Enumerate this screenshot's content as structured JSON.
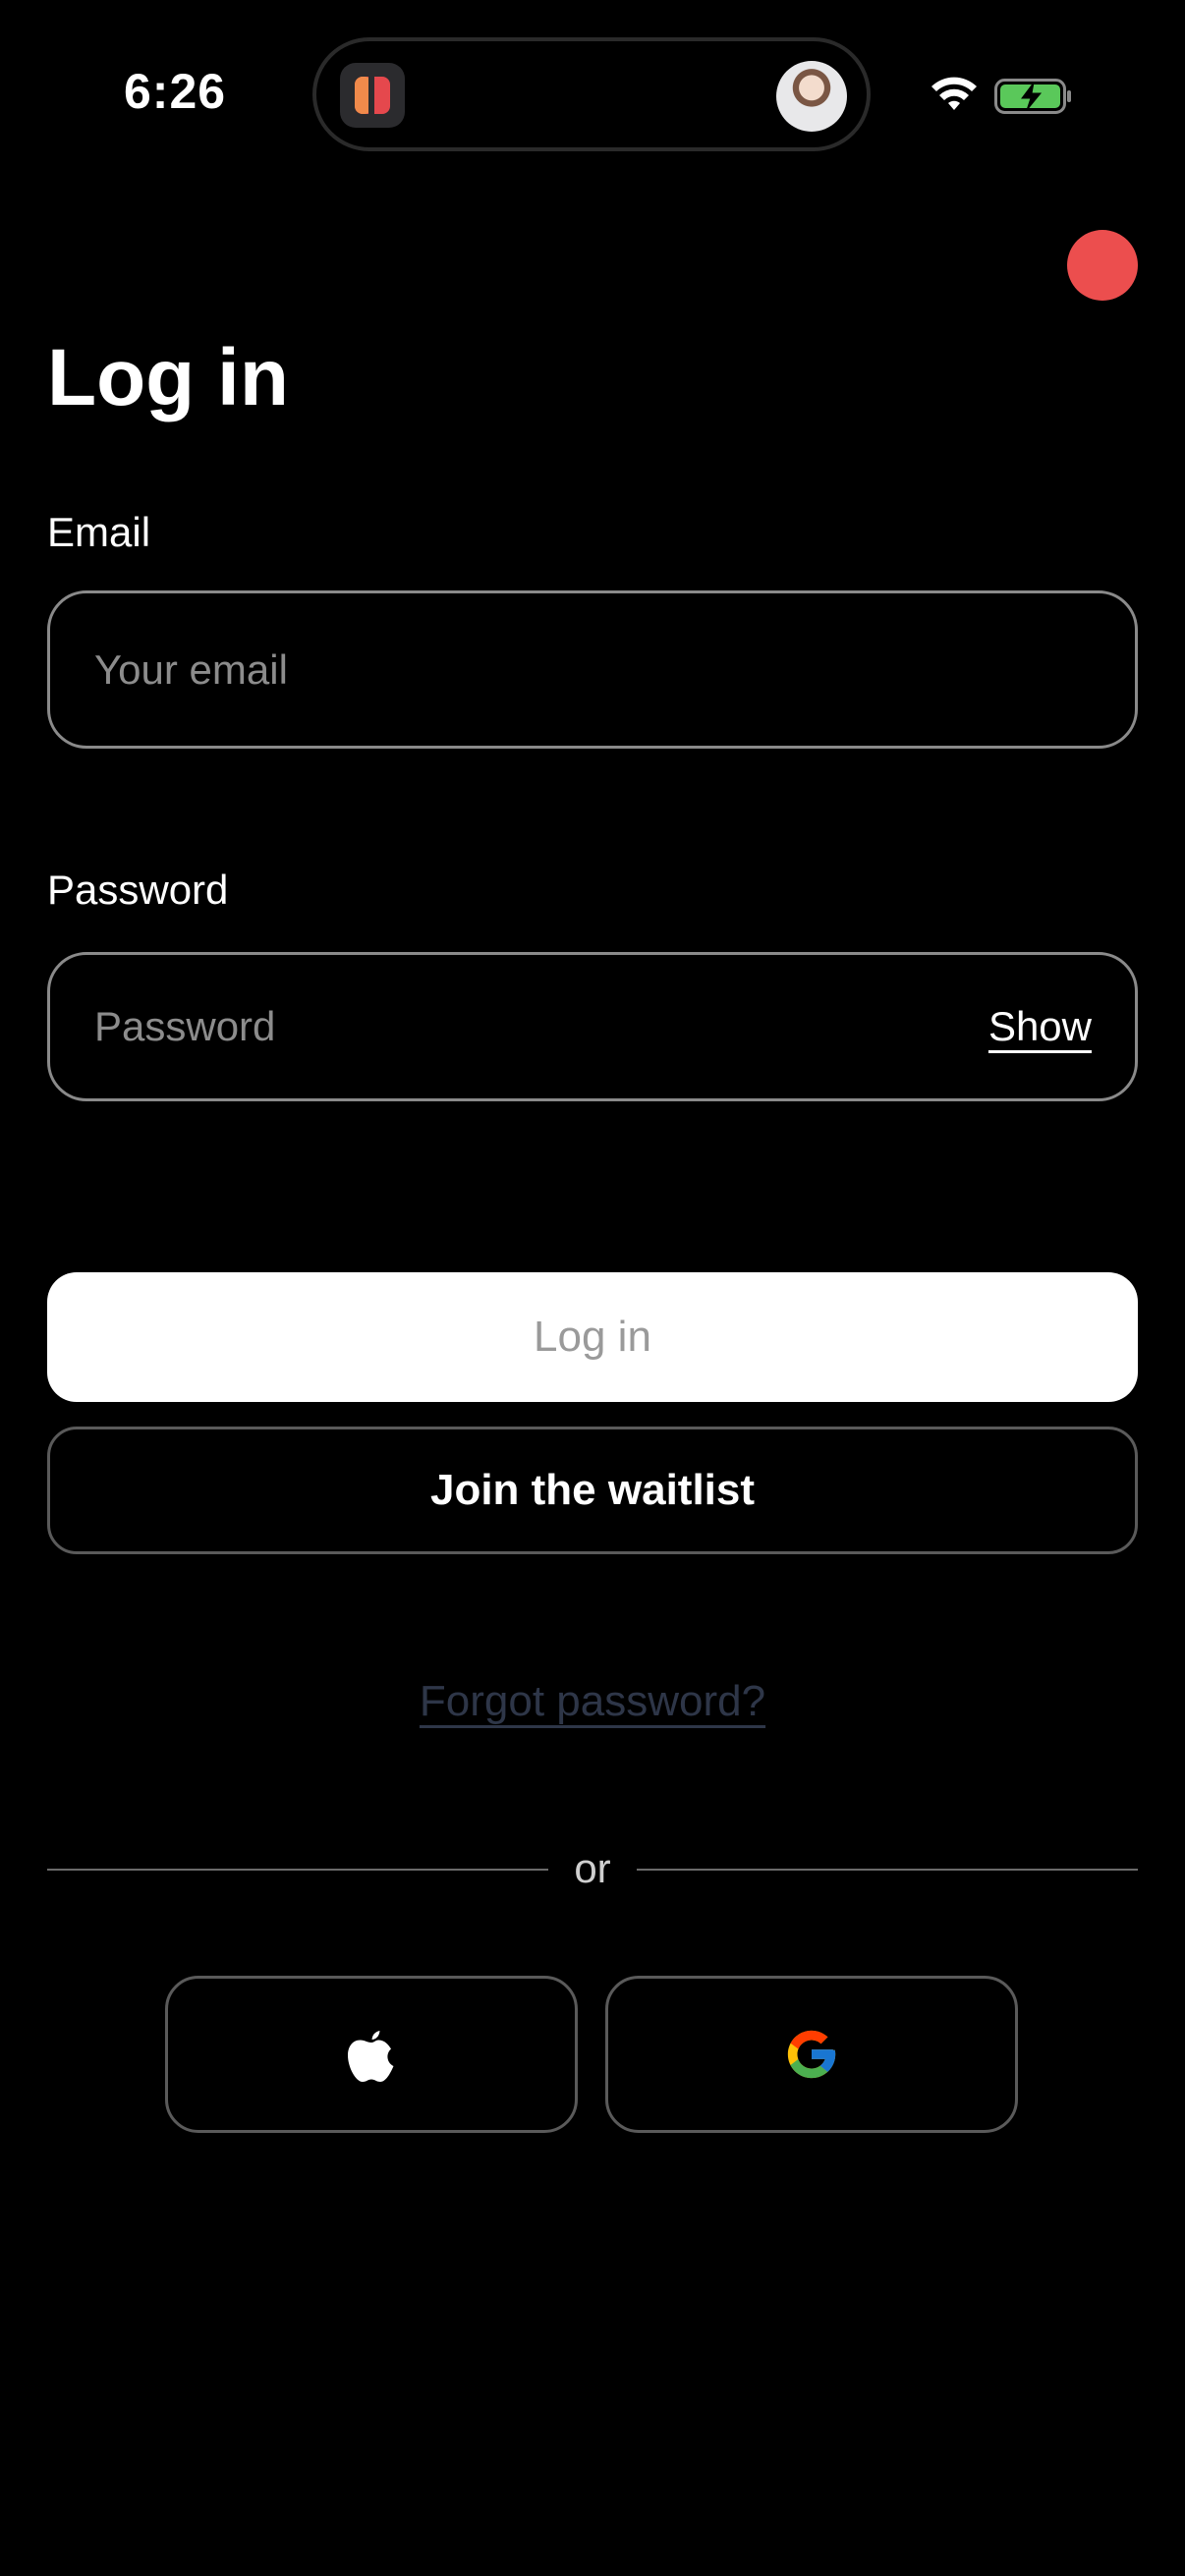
{
  "status_bar": {
    "time": "6:26",
    "icons": [
      "app-icon",
      "avatar",
      "wifi-icon",
      "battery-charging-icon"
    ]
  },
  "page": {
    "title": "Log in"
  },
  "email": {
    "label": "Email",
    "placeholder": "Your email",
    "value": ""
  },
  "password": {
    "label": "Password",
    "placeholder": "Password",
    "value": "",
    "toggle_label": "Show"
  },
  "actions": {
    "login_label": "Log in",
    "waitlist_label": "Join the waitlist",
    "forgot_label": "Forgot password?"
  },
  "divider": {
    "text": "or"
  },
  "social": {
    "apple_icon": "apple-logo-icon",
    "google_icon": "google-logo-icon"
  },
  "colors": {
    "background": "#000000",
    "record_dot": "#ec4e4e",
    "login_button_bg": "#ffffff",
    "login_button_text": "#9a9a9a",
    "forgot_link": "#2e3648",
    "battery_fill": "#5ac85a"
  }
}
